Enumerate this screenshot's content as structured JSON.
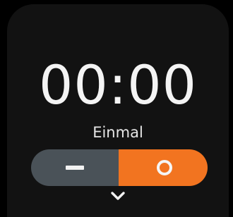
{
  "timer": {
    "time": "00:00",
    "repeat_label": "Einmal"
  },
  "toggle": {
    "off_icon": "dash-icon",
    "on_icon": "ring-icon",
    "state": "on",
    "off_color": "#4a5258",
    "on_color": "#f27420"
  },
  "footer": {
    "more_icon": "chevron-down-icon"
  }
}
